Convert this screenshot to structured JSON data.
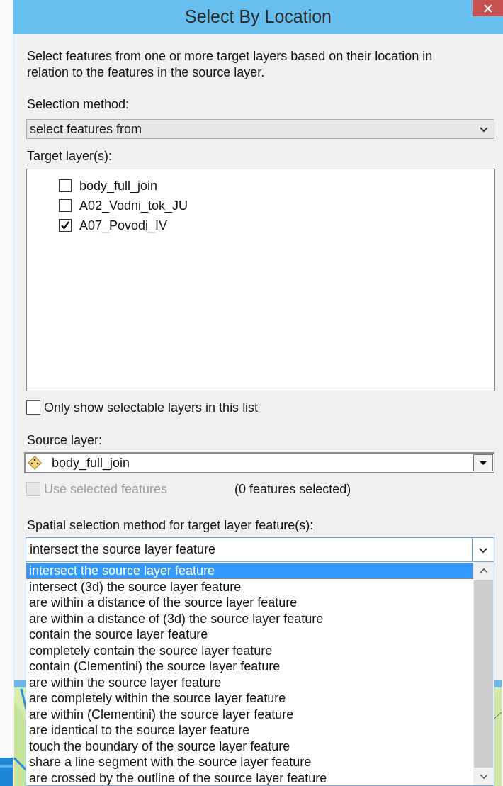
{
  "window": {
    "title": "Select By Location"
  },
  "description": "Select features from one or more target layers based on their location in relation to the features in the source layer.",
  "selection_method": {
    "label": "Selection method:",
    "value": "select features from",
    "disabled": true
  },
  "target_layers": {
    "label": "Target layer(s):",
    "items": [
      {
        "name": "body_full_join",
        "checked": false
      },
      {
        "name": "A02_Vodni_tok_JU",
        "checked": false
      },
      {
        "name": "A07_Povodi_IV",
        "checked": true
      }
    ]
  },
  "only_selectable": {
    "label": "Only show selectable layers in this list",
    "checked": false
  },
  "source_layer": {
    "label": "Source layer:",
    "value": "body_full_join"
  },
  "use_selected": {
    "label": "Use selected features",
    "checked": false,
    "disabled": true
  },
  "features_selected": "(0 features selected)",
  "spatial_method": {
    "label": "Spatial selection method for target layer feature(s):",
    "value": "intersect the source layer feature",
    "expanded": true,
    "options": [
      {
        "label": "intersect the source layer feature",
        "selected": true
      },
      {
        "label": "intersect (3d) the source layer feature",
        "selected": false
      },
      {
        "label": "are within a distance of the source layer feature",
        "selected": false
      },
      {
        "label": "are within a distance of (3d) the source layer feature",
        "selected": false
      },
      {
        "label": "contain the source layer feature",
        "selected": false
      },
      {
        "label": "completely contain the source layer feature",
        "selected": false
      },
      {
        "label": "contain (Clementini) the source layer feature",
        "selected": false
      },
      {
        "label": "are within the source layer feature",
        "selected": false
      },
      {
        "label": "are completely within the source layer feature",
        "selected": false
      },
      {
        "label": "are within (Clementini) the source layer feature",
        "selected": false
      },
      {
        "label": "are identical to the source layer feature",
        "selected": false
      },
      {
        "label": "touch the boundary of the source layer feature",
        "selected": false
      },
      {
        "label": "share a line segment with the source layer feature",
        "selected": false
      },
      {
        "label": "are crossed by the outline of the source layer feature",
        "selected": false
      }
    ]
  }
}
